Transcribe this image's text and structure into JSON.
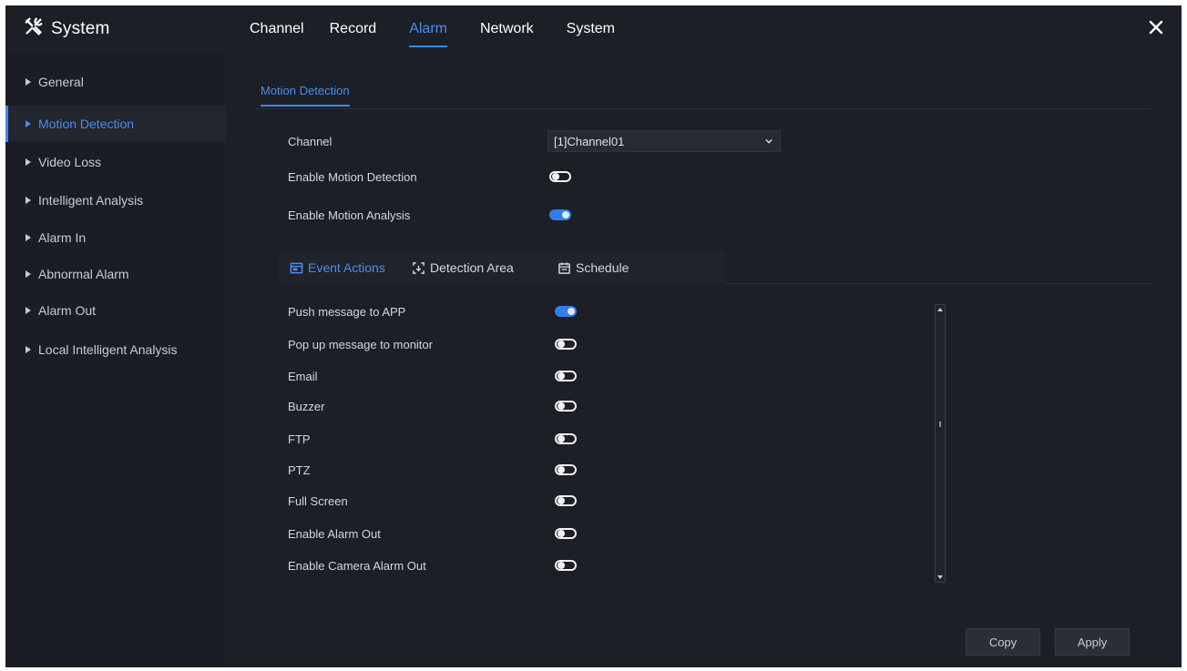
{
  "app": {
    "title": "System",
    "icon": "tools-icon"
  },
  "tabs": [
    {
      "label": "Channel",
      "active": false
    },
    {
      "label": "Record",
      "active": false
    },
    {
      "label": "Alarm",
      "active": true
    },
    {
      "label": "Network",
      "active": false
    },
    {
      "label": "System",
      "active": false
    }
  ],
  "sidebar": {
    "items": [
      {
        "label": "General",
        "active": false
      },
      {
        "label": "Motion Detection",
        "active": true
      },
      {
        "label": "Video Loss",
        "active": false
      },
      {
        "label": "Intelligent Analysis",
        "active": false
      },
      {
        "label": "Alarm In",
        "active": false
      },
      {
        "label": "Abnormal Alarm",
        "active": false
      },
      {
        "label": "Alarm Out",
        "active": false
      },
      {
        "label": "Local Intelligent Analysis",
        "active": false
      }
    ]
  },
  "content": {
    "subtab": "Motion Detection",
    "channel_label": "Channel",
    "channel_value": "[1]Channel01",
    "enable_motion_detection": {
      "label": "Enable Motion Detection",
      "on": false
    },
    "enable_motion_analysis": {
      "label": "Enable Motion Analysis",
      "on": true
    },
    "action_tabs": [
      {
        "label": "Event Actions",
        "icon": "event-icon",
        "active": true
      },
      {
        "label": "Detection Area",
        "icon": "area-icon",
        "active": false
      },
      {
        "label": "Schedule",
        "icon": "calendar-icon",
        "active": false
      }
    ],
    "actions": [
      {
        "label": "Push message to APP",
        "on": true
      },
      {
        "label": "Pop up message to monitor",
        "on": false
      },
      {
        "label": "Email",
        "on": false
      },
      {
        "label": "Buzzer",
        "on": false
      },
      {
        "label": "FTP",
        "on": false
      },
      {
        "label": "PTZ",
        "on": false
      },
      {
        "label": "Full Screen",
        "on": false
      },
      {
        "label": "Enable Alarm Out",
        "on": false
      },
      {
        "label": "Enable Camera Alarm Out",
        "on": false
      }
    ],
    "buttons": {
      "copy": "Copy",
      "apply": "Apply"
    }
  },
  "colors": {
    "accent": "#3d86f5",
    "background": "#1c1f26",
    "sidebar": "#1a1d23"
  }
}
